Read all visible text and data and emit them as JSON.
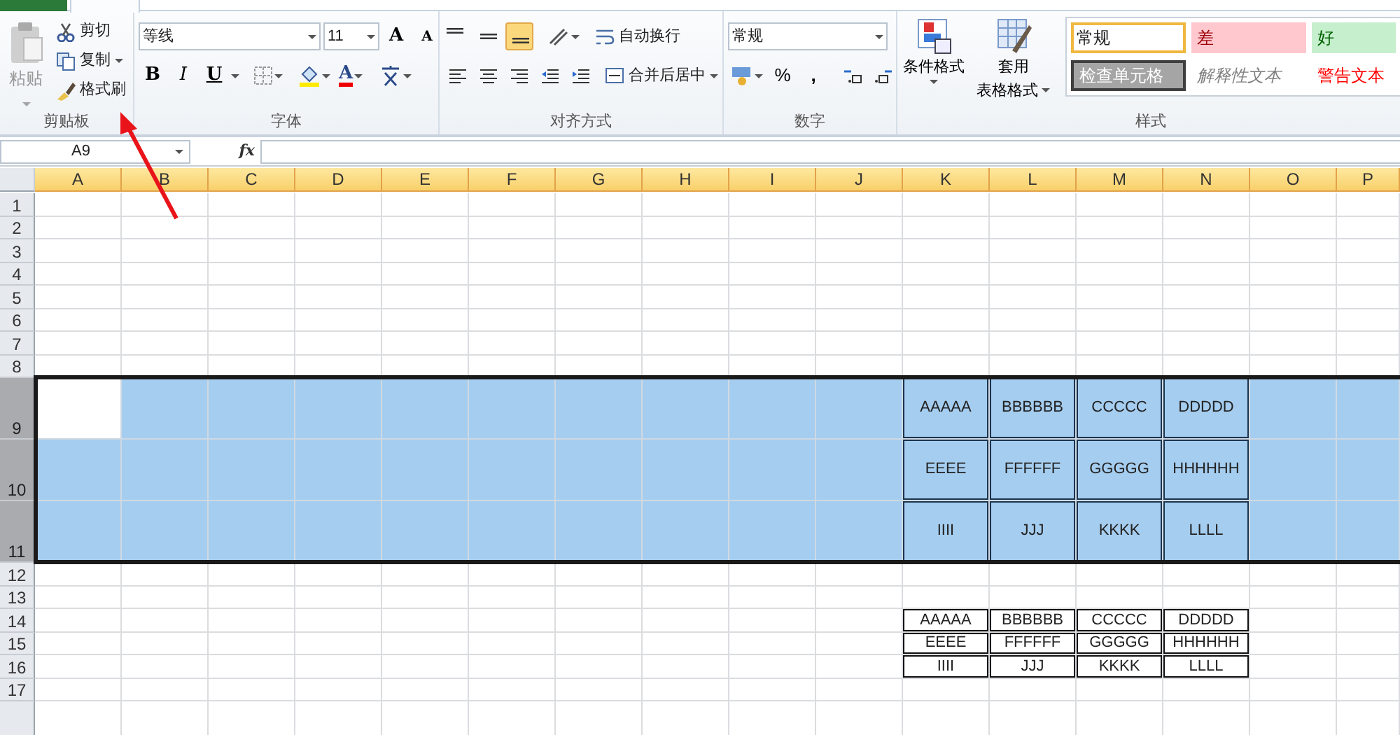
{
  "clipboard": {
    "label": "剪贴板",
    "paste": "粘贴",
    "paste_disabled": true,
    "cut": "剪切",
    "copy": "复制",
    "format_painter": "格式刷"
  },
  "font": {
    "label": "字体",
    "family": "等线",
    "size": "11",
    "grow": "A",
    "shrink": "A",
    "bold": "B",
    "italic": "I",
    "underline": "U",
    "color_letter": "A"
  },
  "alignment": {
    "label": "对齐方式",
    "wrap_text": "自动换行",
    "merge_center": "合并后居中",
    "vertical_align": [
      {
        "selected": false
      },
      {
        "selected": false
      },
      {
        "selected": true
      }
    ]
  },
  "number": {
    "label": "数字",
    "format": "常规",
    "percent": "%",
    "comma": ","
  },
  "styles": {
    "label": "样式",
    "conditional_format": "条件格式",
    "table_format": [
      "套用",
      "表格格式"
    ],
    "gallery": [
      {
        "text": "常规",
        "kind": "normal",
        "selected": true
      },
      {
        "text": "差",
        "kind": "bad",
        "selected": false
      },
      {
        "text": "好",
        "kind": "good",
        "selected": false
      },
      {
        "text": "检查单元格",
        "kind": "check",
        "selected": false
      },
      {
        "text": "解释性文本",
        "kind": "explanatory",
        "selected": false
      },
      {
        "text": "警告文本",
        "kind": "warning",
        "selected": false
      }
    ]
  },
  "formula_bar": {
    "name_box": "A9",
    "fx": "fx"
  },
  "sheet": {
    "columns": [
      {
        "label": "A",
        "selected": true
      },
      {
        "label": "B",
        "selected": true
      },
      {
        "label": "C",
        "selected": true
      },
      {
        "label": "D",
        "selected": true
      },
      {
        "label": "E",
        "selected": true
      },
      {
        "label": "F",
        "selected": true
      },
      {
        "label": "G",
        "selected": true
      },
      {
        "label": "H",
        "selected": true
      },
      {
        "label": "I",
        "selected": true
      },
      {
        "label": "J",
        "selected": true
      },
      {
        "label": "K",
        "selected": true
      },
      {
        "label": "L",
        "selected": true
      },
      {
        "label": "M",
        "selected": true
      },
      {
        "label": "N",
        "selected": true
      },
      {
        "label": "O",
        "selected": true
      },
      {
        "label": "P",
        "selected": true
      }
    ],
    "rows": [
      {
        "label": "1",
        "kind": "normal",
        "selected": false
      },
      {
        "label": "2",
        "kind": "normal",
        "selected": false
      },
      {
        "label": "3",
        "kind": "normal",
        "selected": false
      },
      {
        "label": "4",
        "kind": "normal",
        "selected": false
      },
      {
        "label": "5",
        "kind": "normal",
        "selected": false
      },
      {
        "label": "6",
        "kind": "normal",
        "selected": false
      },
      {
        "label": "7",
        "kind": "normal",
        "selected": false
      },
      {
        "label": "8",
        "kind": "normal",
        "selected": false
      },
      {
        "label": "9",
        "kind": "tall",
        "selected": true,
        "cells": [
          {
            "active": true
          },
          null,
          null,
          null,
          null,
          null,
          null,
          null,
          null,
          null,
          {
            "text": "AAAAA"
          },
          {
            "text": "BBBBBB"
          },
          {
            "text": "CCCCC"
          },
          {
            "text": "DDDDD"
          },
          null,
          null
        ]
      },
      {
        "label": "10",
        "kind": "tall",
        "selected": true,
        "cells": [
          null,
          null,
          null,
          null,
          null,
          null,
          null,
          null,
          null,
          null,
          {
            "text": "EEEE"
          },
          {
            "text": "FFFFFF"
          },
          {
            "text": "GGGGG"
          },
          {
            "text": "HHHHHH"
          },
          null,
          null
        ]
      },
      {
        "label": "11",
        "kind": "tall",
        "selected": true,
        "cells": [
          null,
          null,
          null,
          null,
          null,
          null,
          null,
          null,
          null,
          null,
          {
            "text": "IIII"
          },
          {
            "text": "JJJ"
          },
          {
            "text": "KKKK"
          },
          {
            "text": "LLLL"
          },
          null,
          null
        ]
      },
      {
        "label": "12",
        "kind": "normal",
        "selected": false
      },
      {
        "label": "13",
        "kind": "normal",
        "selected": false
      },
      {
        "label": "14",
        "kind": "normal",
        "selected": false,
        "cells": [
          null,
          null,
          null,
          null,
          null,
          null,
          null,
          null,
          null,
          null,
          {
            "text": "AAAAA"
          },
          {
            "text": "BBBBBB"
          },
          {
            "text": "CCCCC"
          },
          {
            "text": "DDDDD"
          },
          null,
          null
        ]
      },
      {
        "label": "15",
        "kind": "normal",
        "selected": false,
        "cells": [
          null,
          null,
          null,
          null,
          null,
          null,
          null,
          null,
          null,
          null,
          {
            "text": "EEEE"
          },
          {
            "text": "FFFFFF"
          },
          {
            "text": "GGGGG"
          },
          {
            "text": "HHHHHH"
          },
          null,
          null
        ]
      },
      {
        "label": "16",
        "kind": "normal",
        "selected": false,
        "cells": [
          null,
          null,
          null,
          null,
          null,
          null,
          null,
          null,
          null,
          null,
          {
            "text": "IIII"
          },
          {
            "text": "JJJ"
          },
          {
            "text": "KKKK"
          },
          {
            "text": "LLLL"
          },
          null,
          null
        ]
      },
      {
        "label": "17",
        "kind": "normal",
        "selected": false
      }
    ]
  }
}
